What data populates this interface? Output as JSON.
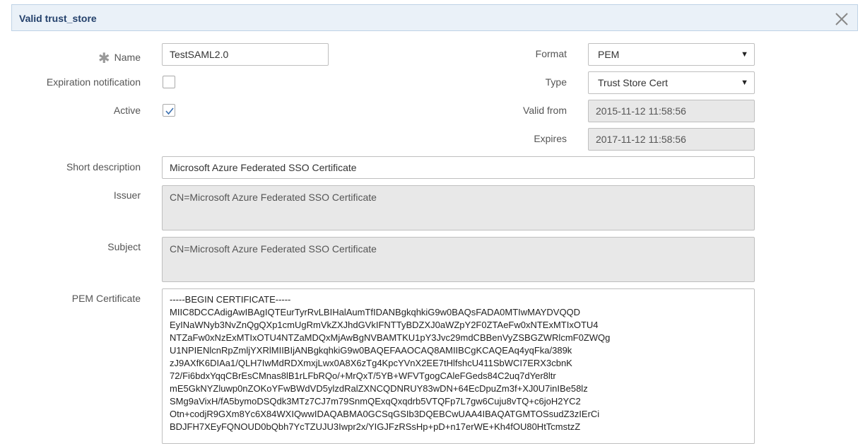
{
  "banner": {
    "title": "Valid trust_store"
  },
  "labels": {
    "name": "Name",
    "expiration_notification": "Expiration notification",
    "active": "Active",
    "short_description": "Short description",
    "issuer": "Issuer",
    "subject": "Subject",
    "pem_certificate": "PEM Certificate",
    "format": "Format",
    "type": "Type",
    "valid_from": "Valid from",
    "expires": "Expires"
  },
  "required_marker": "✱",
  "fields": {
    "name": "TestSAML2.0",
    "expiration_notification_checked": false,
    "active_checked": true,
    "format": "PEM",
    "type": "Trust Store Cert",
    "valid_from": "2015-11-12 11:58:56",
    "expires": "2017-11-12 11:58:56",
    "short_description": "Microsoft Azure Federated SSO Certificate",
    "issuer": "CN=Microsoft Azure Federated SSO Certificate",
    "subject": "CN=Microsoft Azure Federated SSO Certificate"
  },
  "pem_lines": [
    "-----BEGIN CERTIFICATE-----",
    "MIIC8DCCAdigAwIBAgIQTEurTyrRvLBIHalAumTfIDANBgkqhkiG9w0BAQsFADA0MTIwMAYDVQQD",
    "EyINaWNyb3NvZnQgQXp1cmUgRmVkZXJhdGVkIFNTTyBDZXJ0aWZpY2F0ZTAeFw0xNTExMTIxOTU4",
    "NTZaFw0xNzExMTIxOTU4NTZaMDQxMjAwBgNVBAMTKU1pY3Jvc29mdCBBenVyZSBGZWRlcmF0ZWQg",
    "U1NPIENlcnRpZmljYXRlMIIBIjANBgkqhkiG9w0BAQEFAAOCAQ8AMIIBCgKCAQEAq4yqFka/389k",
    "zJ9AXfK6DIAa1/QLH7IwMdRDXmxjLwx0A8X6zTg4KpcYVnX2EE7tHlfshcU411SbWCI7ERX3cbnK",
    "72/Fi6bdxYqqCBrEsCMnas8lB1rLFbRQo/+MrQxT/5YB+WFVTgogCAleFGeds84C2uq7dYer8ltr",
    "mE5GkNYZluwp0nZOKoYFwBWdVD5ylzdRalZXNCQDNRUY83wDN+64EcDpuZm3f+XJ0U7inIBe58lz",
    "SMg9aVixH/fA5bymoDSQdk3MTz7CJ7m79SnmQExqQxqdrb5VTQFp7L7gw6Cuju8vTQ+c6joH2YC2",
    "Otn+codjR9GXm8Yc6X84WXIQwwIDAQABMA0GCSqGSIb3DQEBCwUAA4IBAQATGMTOSsudZ3zIErCi",
    "BDJFH7XEyFQNOUD0bQbh7YcTZUJU3Iwpr2x/YIGJFzRSsHp+pD+n17erWE+Kh4fOU80HtTcmstzZ"
  ]
}
